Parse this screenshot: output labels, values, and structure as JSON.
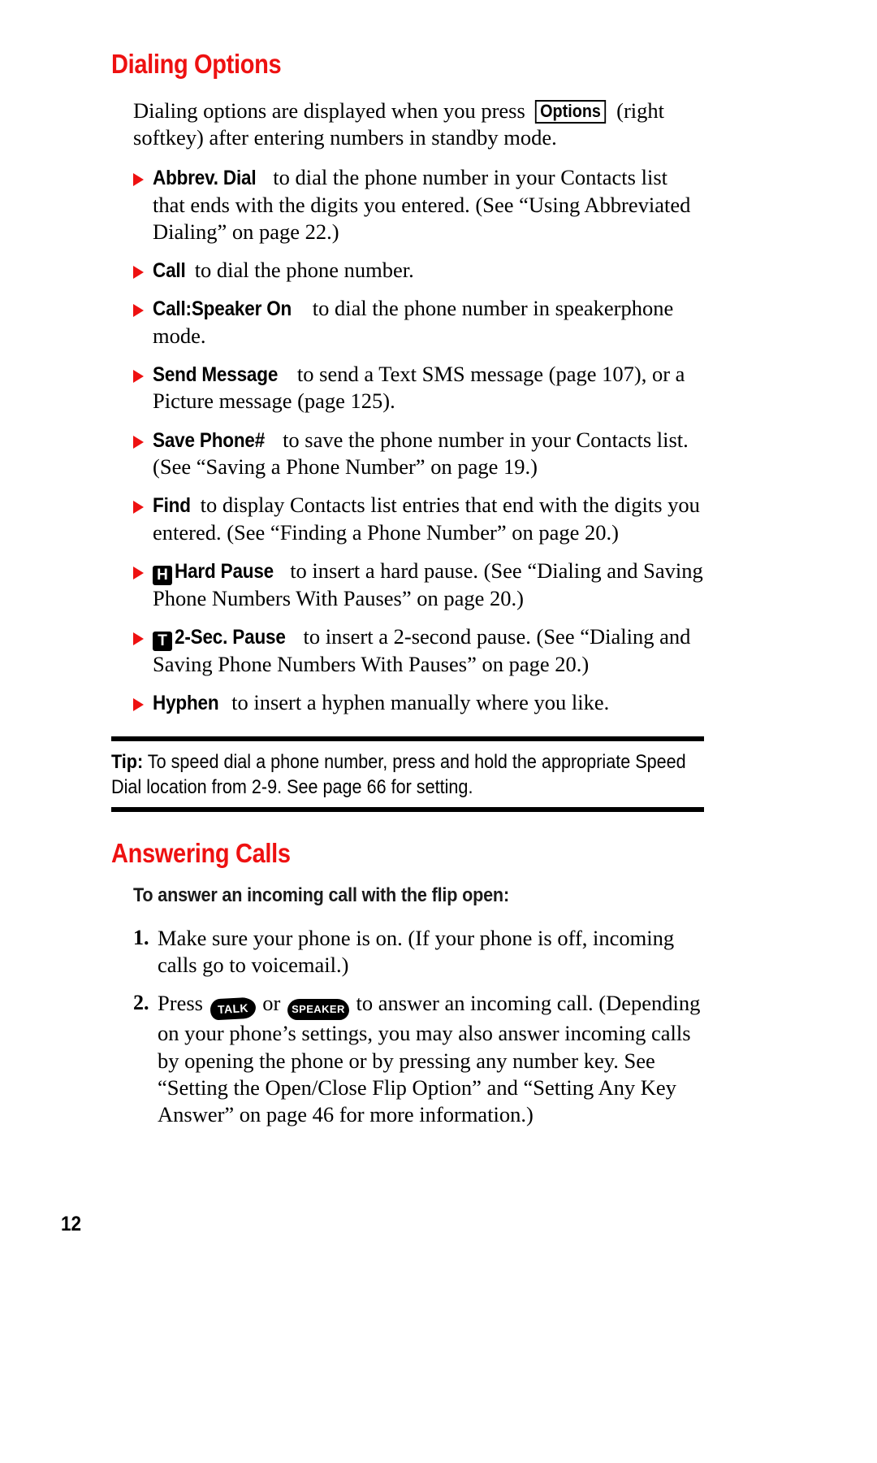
{
  "page": {
    "folio": "12"
  },
  "section1": {
    "heading": "Dialing Options",
    "intro": {
      "before": "Dialing options are displayed when you press",
      "softkey": "Options",
      "after": "(right softkey) after entering numbers in standby mode."
    },
    "bullets": [
      {
        "icon": "",
        "term": "Abbrev. Dial",
        "text": "to dial the phone number in your Contacts list that ends with the digits you entered. (See “Using Abbreviated Dialing” on page 22.)"
      },
      {
        "icon": "",
        "term": "Call",
        "text": "to dial the phone number."
      },
      {
        "icon": "",
        "term": "Call:Speaker On",
        "text": "to dial the phone number in speakerphone mode."
      },
      {
        "icon": "",
        "term": "Send Message",
        "text": "to send a Text SMS message (page 107), or a Picture message (page 125)."
      },
      {
        "icon": "",
        "term": "Save Phone#",
        "text": "to save the phone number in your Contacts list. (See “Saving a Phone Number” on page 19.)"
      },
      {
        "icon": "",
        "term": "Find",
        "text": "to display Contacts list entries that end with the digits you entered. (See “Finding a Phone Number” on page 20.)"
      },
      {
        "icon": "H",
        "term": "Hard Pause",
        "text": "to insert a hard pause. (See “Dialing and Saving Phone Numbers With Pauses” on page 20.)"
      },
      {
        "icon": "T",
        "term": "2-Sec. Pause",
        "text": "to insert a 2-second pause. (See “Dialing and Saving Phone Numbers With Pauses” on page 20.)"
      },
      {
        "icon": "",
        "term": "Hyphen",
        "text": "to insert a hyphen manually where you like."
      }
    ],
    "tip": {
      "label": "Tip:",
      "text": "To speed dial a phone number, press and hold the appropriate Speed Dial location from 2-9. See page 66 for setting."
    }
  },
  "section2": {
    "heading": "Answering Calls",
    "subheading": "To answer an incoming call with the flip open:",
    "steps": [
      {
        "num": "1.",
        "text": "Make sure your phone is on. (If your phone is off, incoming calls go to voicemail.)"
      },
      {
        "num": "2.",
        "before": "Press",
        "key1": "TALK",
        "conjunction": "or",
        "key2": "SPEAKER",
        "after": "to answer an incoming call. (Depending on your phone’s settings, you may also answer incoming calls by opening the phone or by pressing any number key. See “Setting the Open/Close Flip Option” and “Setting Any Key Answer” on page 46 for more information.)"
      }
    ]
  },
  "colors": {
    "heading_red": "#ee1111",
    "bullet_red": "#ee1111",
    "text_black": "#000000"
  }
}
